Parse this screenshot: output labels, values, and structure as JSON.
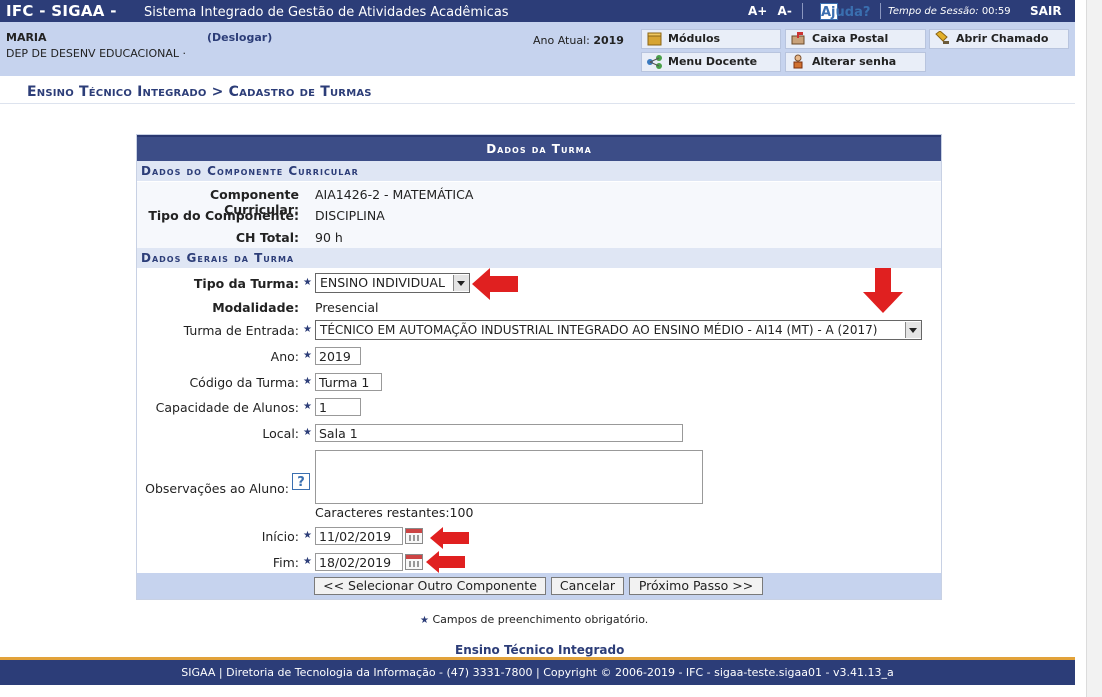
{
  "topbar": {
    "system": "IFC - SIGAA -",
    "system_name": "Sistema Integrado de Gestão de Atividades Acadêmicas",
    "font_up": "A+",
    "font_down": "A-",
    "help": "Ajuda?",
    "session_label": "Tempo de Sessão:",
    "session_time": "00:59",
    "logout": "SAIR"
  },
  "user": {
    "name": "MARIA",
    "logout_link": "(Deslogar)",
    "department": "DEP DE DESENV EDUCACIONAL ·",
    "year_label": "Ano Atual:",
    "year_value": "2019"
  },
  "quick_links": [
    {
      "label": "Módulos",
      "icon": "modules-icon"
    },
    {
      "label": "Caixa Postal",
      "icon": "mailbox-icon"
    },
    {
      "label": "Abrir Chamado",
      "icon": "ticket-icon"
    },
    {
      "label": "Menu Docente",
      "icon": "teacher-menu-icon"
    },
    {
      "label": "Alterar senha",
      "icon": "change-password-icon"
    }
  ],
  "breadcrumb": "Ensino Técnico Integrado > Cadastro de Turmas",
  "form": {
    "caption": "Dados da Turma",
    "section1": "Dados do Componente Curricular",
    "componente_label": "Componente Curricular:",
    "componente_value": "AIA1426-2 - MATEMÁTICA",
    "tipo_comp_label": "Tipo do Componente:",
    "tipo_comp_value": "DISCIPLINA",
    "ch_label": "CH Total:",
    "ch_value": "90 h",
    "section2": "Dados Gerais da Turma",
    "tipo_turma_label": "Tipo da Turma:",
    "tipo_turma_value": "ENSINO INDIVIDUAL",
    "modalidade_label": "Modalidade:",
    "modalidade_value": "Presencial",
    "turma_entrada_label": "Turma de Entrada:",
    "turma_entrada_value": "TÉCNICO EM AUTOMAÇÃO INDUSTRIAL INTEGRADO AO ENSINO MÉDIO - AI14 (MT) - A (2017)",
    "ano_label": "Ano:",
    "ano_value": "2019",
    "codigo_label": "Código da Turma:",
    "codigo_value": "Turma 1",
    "capacidade_label": "Capacidade de Alunos:",
    "capacidade_value": "1",
    "local_label": "Local:",
    "local_value": "Sala 1",
    "obs_label": "Observações ao Aluno:",
    "obs_value": "",
    "chars_left": "Caracteres restantes:100",
    "inicio_label": "Início:",
    "inicio_value": "11/02/2019",
    "fim_label": "Fim:",
    "fim_value": "18/02/2019",
    "btn_select": "<< Selecionar Outro Componente",
    "btn_cancel": "Cancelar",
    "btn_next": "Próximo Passo >>"
  },
  "legend": "Campos de preenchimento obrigatório.",
  "program_link": "Ensino Técnico Integrado",
  "footer": "SIGAA | Diretoria de Tecnologia da Informação - (47) 3331-7800 | Copyright © 2006-2019 - IFC - sigaa-teste.sigaa01 - v3.41.13_a",
  "colors": {
    "header": "#2c3d78",
    "accent": "#e2a23a",
    "annotation_arrow": "#e02020"
  }
}
